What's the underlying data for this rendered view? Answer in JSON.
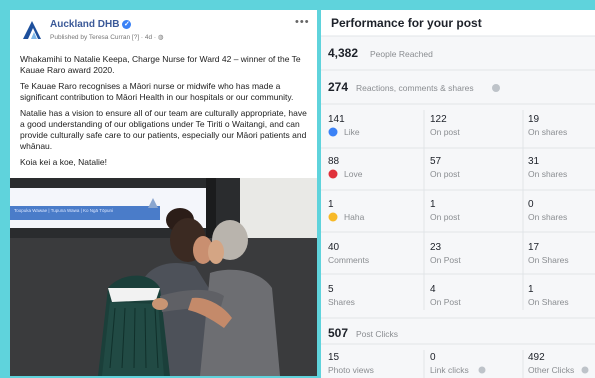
{
  "post": {
    "page_name": "Auckland DHB",
    "published": "Published by Teresa Curran [?] · 4d · ",
    "paragraphs": [
      "Whakamihi to Natalie Keepa, Charge Nurse for Ward 42 – winner of the Te Kauae Raro award 2020.",
      "Te Kauae Raro recognises a Māori nurse or midwife who has made a significant contribution to Māori Health in our hospitals or our community.",
      "Natalie has a vision to ensure all of our team are culturally appropriate, have a good understanding of our obligations under Te Tiriti o Waitangi, and can provide culturally safe care to our patients, especially our Māori patients and whānau.",
      "Koia kei a koe, Natalie!"
    ],
    "photo_screen_text": "Toopuka Wawae | Tupuna Wawa | Ko Ngā Tōpuni"
  },
  "performance": {
    "title": "Performance for your post",
    "reached_value": "4,382",
    "reached_label": "People Reached",
    "reactions_value": "274",
    "reactions_label": "Reactions, comments & shares",
    "rows": [
      {
        "total": "141",
        "label": "Like",
        "icon": "like-icon",
        "post": "122",
        "post_label": "On post",
        "shares": "19",
        "shares_label": "On shares"
      },
      {
        "total": "88",
        "label": "Love",
        "icon": "love-icon",
        "post": "57",
        "post_label": "On post",
        "shares": "31",
        "shares_label": "On shares"
      },
      {
        "total": "1",
        "label": "Haha",
        "icon": "haha-icon",
        "post": "1",
        "post_label": "On post",
        "shares": "0",
        "shares_label": "On shares"
      },
      {
        "total": "40",
        "label": "Comments",
        "icon": "",
        "post": "23",
        "post_label": "On Post",
        "shares": "17",
        "shares_label": "On Shares"
      },
      {
        "total": "5",
        "label": "Shares",
        "icon": "",
        "post": "4",
        "post_label": "On Post",
        "shares": "1",
        "shares_label": "On Shares"
      }
    ],
    "clicks_value": "507",
    "clicks_label": "Post Clicks",
    "clicks": [
      {
        "value": "15",
        "label": "Photo views"
      },
      {
        "value": "0",
        "label": "Link clicks"
      },
      {
        "value": "492",
        "label": "Other Clicks"
      }
    ]
  }
}
